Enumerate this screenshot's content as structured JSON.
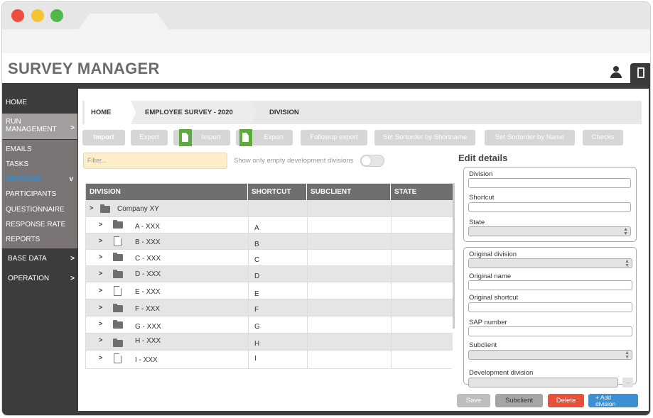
{
  "app": {
    "title": "SURVEY MANAGER"
  },
  "sidebar": {
    "items": [
      {
        "label": "HOME"
      },
      {
        "label": "RUN",
        "label2": "MANAGEMENT",
        "arrow": ">"
      },
      {
        "label": "EMAILS"
      },
      {
        "label": "TASKS"
      },
      {
        "label": "DIVISIONS",
        "arrow": "v"
      },
      {
        "label": "PARTICIPANTS"
      },
      {
        "label": "QUESTIONNAIRE"
      },
      {
        "label": "RESPONSE RATE"
      },
      {
        "label": "REPORTS"
      },
      {
        "label": "BASE DATA",
        "arrow": ">"
      },
      {
        "label": "OPERATION",
        "arrow": ">"
      }
    ]
  },
  "breadcrumb": [
    "HOME",
    "EMPLOYEE SURVEY - 2020",
    "DIVISION"
  ],
  "toolbar": {
    "buttons": [
      "Import",
      "Export",
      "Import",
      "Export",
      "Followup export",
      "Set Sortorder by Shortname",
      "Set Sortorder by Name",
      "Checks"
    ]
  },
  "filter": {
    "placeholder": "Filter...",
    "toggle_label": "Show only empty development divisions"
  },
  "table": {
    "columns": [
      "DIVISION",
      "SHORTCUT",
      "SUBCLIENT",
      "STATE"
    ],
    "root": {
      "arrow": ">",
      "name": "Company XY"
    },
    "rows": [
      {
        "arrow": ">",
        "icon": "folder",
        "name": "A - XXX",
        "shortcut": "A"
      },
      {
        "arrow": ">",
        "icon": "doc",
        "name": "B - XXX",
        "shortcut": "B"
      },
      {
        "arrow": ">",
        "icon": "folder",
        "name": "C - XXX",
        "shortcut": "C"
      },
      {
        "arrow": ">",
        "icon": "folder",
        "name": "D - XXX",
        "shortcut": "D"
      },
      {
        "arrow": ">",
        "icon": "doc",
        "name": "E - XXX",
        "shortcut": "E"
      },
      {
        "arrow": ">",
        "icon": "folder",
        "name": "F - XXX",
        "shortcut": "F"
      },
      {
        "arrow": ">",
        "icon": "folder",
        "name": "G - XXX",
        "shortcut": "G"
      },
      {
        "arrow": ">",
        "icon": "folder",
        "name": "H - XXX",
        "shortcut": "H"
      },
      {
        "arrow": ">",
        "icon": "doc",
        "name": "I - XXX",
        "shortcut": "I"
      }
    ]
  },
  "edit": {
    "title": "Edit details",
    "group1": [
      "Division",
      "Shortcut",
      "State"
    ],
    "group2": [
      "Original division",
      "Original name",
      "Original shortcut",
      "SAP number",
      "Subclient"
    ],
    "dev_label": "Development division",
    "dev_button": "..."
  },
  "actions": {
    "save": "Save",
    "subclient": "Subclient",
    "delete": "Delete",
    "add_line1": "+ Add",
    "add_line2": "division"
  },
  "colors": {
    "delete": "#e8503a",
    "add": "#3d8fd4",
    "green_icon": "#5caa3c",
    "header_gray": "#6f6f6f"
  }
}
